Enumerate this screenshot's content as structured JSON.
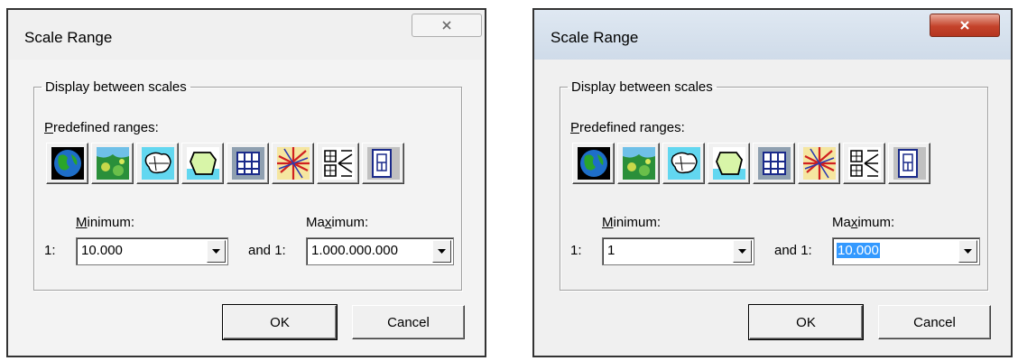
{
  "dialogs": [
    {
      "title": "Scale Range",
      "group_label": "Display between scales",
      "predefined_pre": "",
      "predefined_u": "P",
      "predefined_post": "redefined ranges:",
      "min_pre": "",
      "min_u": "M",
      "min_post": "inimum:",
      "max_pre": "Ma",
      "max_u": "x",
      "max_post": "imum:",
      "prefix1": "1:",
      "and_label": "and 1:",
      "min_value": "10.000",
      "max_value": "1.000.000.000",
      "ok": "OK",
      "cancel": "Cancel"
    },
    {
      "title": "Scale Range",
      "group_label": "Display between scales",
      "predefined_pre": "",
      "predefined_u": "P",
      "predefined_post": "redefined ranges:",
      "min_pre": "",
      "min_u": "M",
      "min_post": "inimum:",
      "max_pre": "Ma",
      "max_u": "x",
      "max_post": "imum:",
      "prefix1": "1:",
      "and_label": "and 1:",
      "min_value": "1",
      "max_value": "10.000",
      "ok": "OK",
      "cancel": "Cancel"
    }
  ],
  "range_icons": [
    "globe-icon",
    "continent-map-icon",
    "country-map-icon",
    "region-map-icon",
    "city-map-icon",
    "street-map-icon",
    "neighborhood-map-icon",
    "building-plan-icon"
  ],
  "colors": {
    "close_active": "#c4432b",
    "selection": "#3399ff"
  }
}
